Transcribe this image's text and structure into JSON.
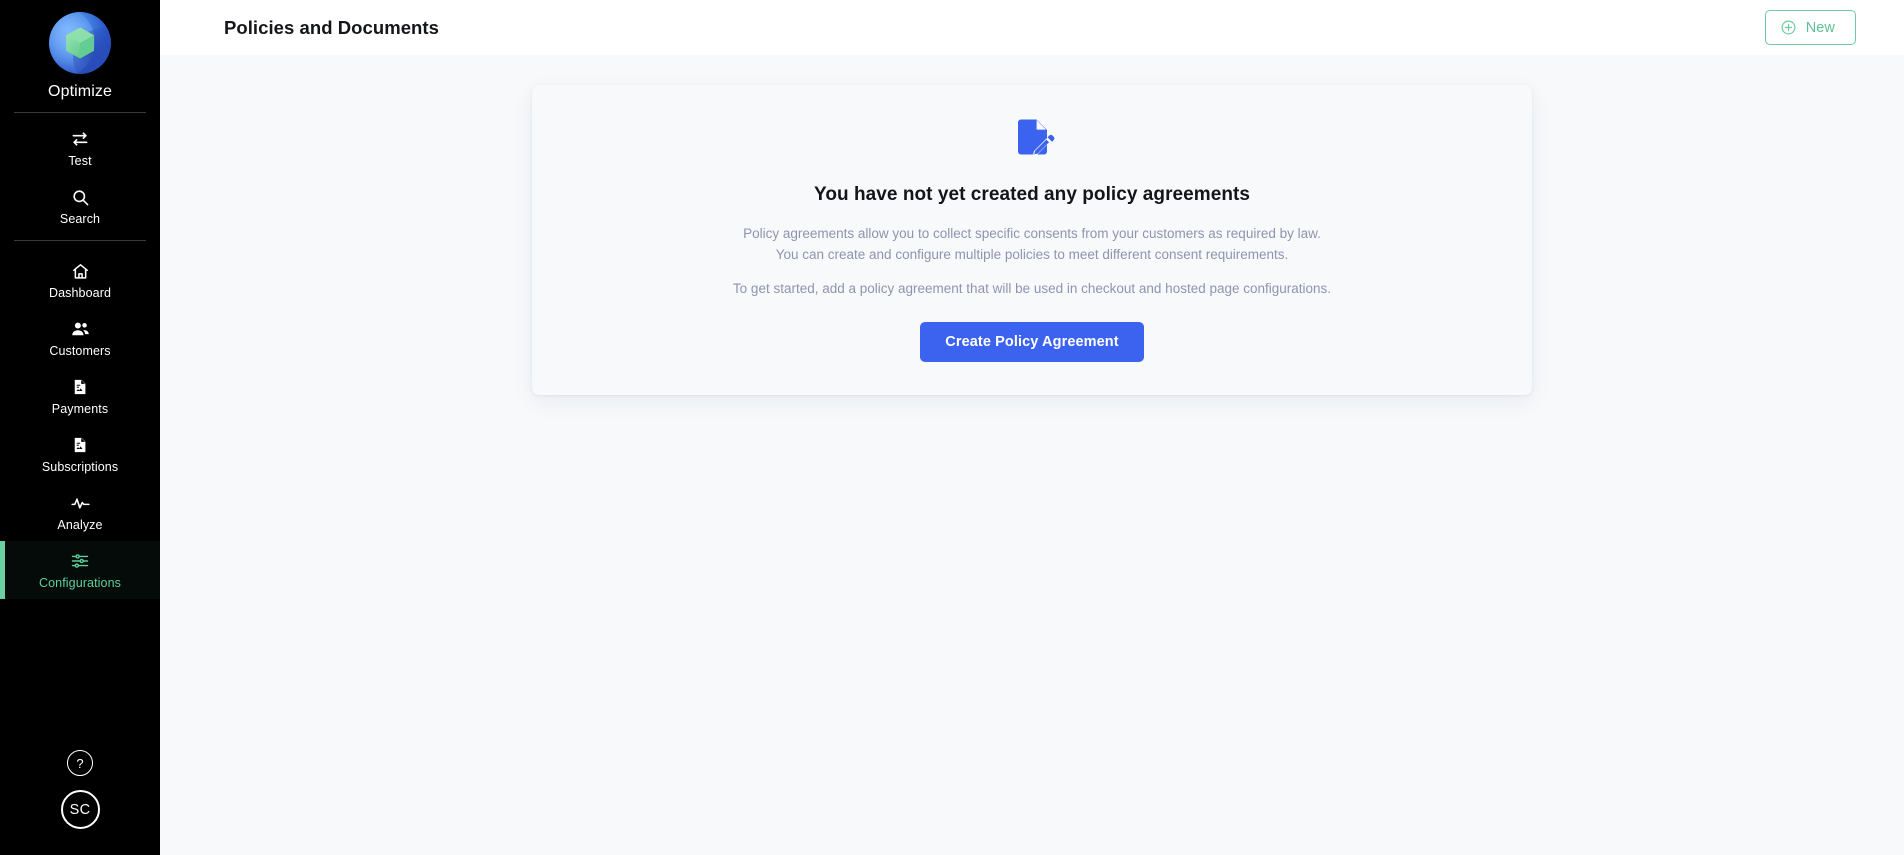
{
  "colors": {
    "sidebar_bg": "#000000",
    "accent_green": "#6bd0a2",
    "accent_blue": "#3b63f0",
    "page_bg": "#f7f9fb",
    "card_bg": "#f8f9fb",
    "muted_text": "#8e94ae"
  },
  "sidebar": {
    "brand_name": "Optimize",
    "logo_icon": "optimize-globe-hexagon-logo",
    "groups": [
      {
        "items": [
          {
            "label": "Test",
            "icon": "transfer-arrows-icon",
            "active": false
          },
          {
            "label": "Search",
            "icon": "search-icon",
            "active": false
          }
        ]
      },
      {
        "items": [
          {
            "label": "Dashboard",
            "icon": "home-icon",
            "active": false
          },
          {
            "label": "Customers",
            "icon": "users-icon",
            "active": false
          },
          {
            "label": "Payments",
            "icon": "document-receipt-icon",
            "active": false
          },
          {
            "label": "Subscriptions",
            "icon": "document-receipt-icon",
            "active": false
          },
          {
            "label": "Analyze",
            "icon": "activity-pulse-icon",
            "active": false
          },
          {
            "label": "Configurations",
            "icon": "sliders-icon",
            "active": true
          }
        ]
      }
    ],
    "help_label": "?",
    "help_icon": "question-mark-circle-icon",
    "avatar_initials": "SC"
  },
  "topbar": {
    "title": "Policies and Documents",
    "new_button_label": "New",
    "new_button_icon": "plus-circle-icon"
  },
  "empty_state": {
    "icon": "document-pencil-icon",
    "title": "You have not yet created any policy agreements",
    "paragraph_1": "Policy agreements allow you to collect specific consents from your customers as required by law. You can create and configure multiple policies to meet different consent requirements.",
    "paragraph_2": "To get started, add a policy agreement that will be used in checkout and hosted page configurations.",
    "cta_label": "Create Policy Agreement"
  }
}
